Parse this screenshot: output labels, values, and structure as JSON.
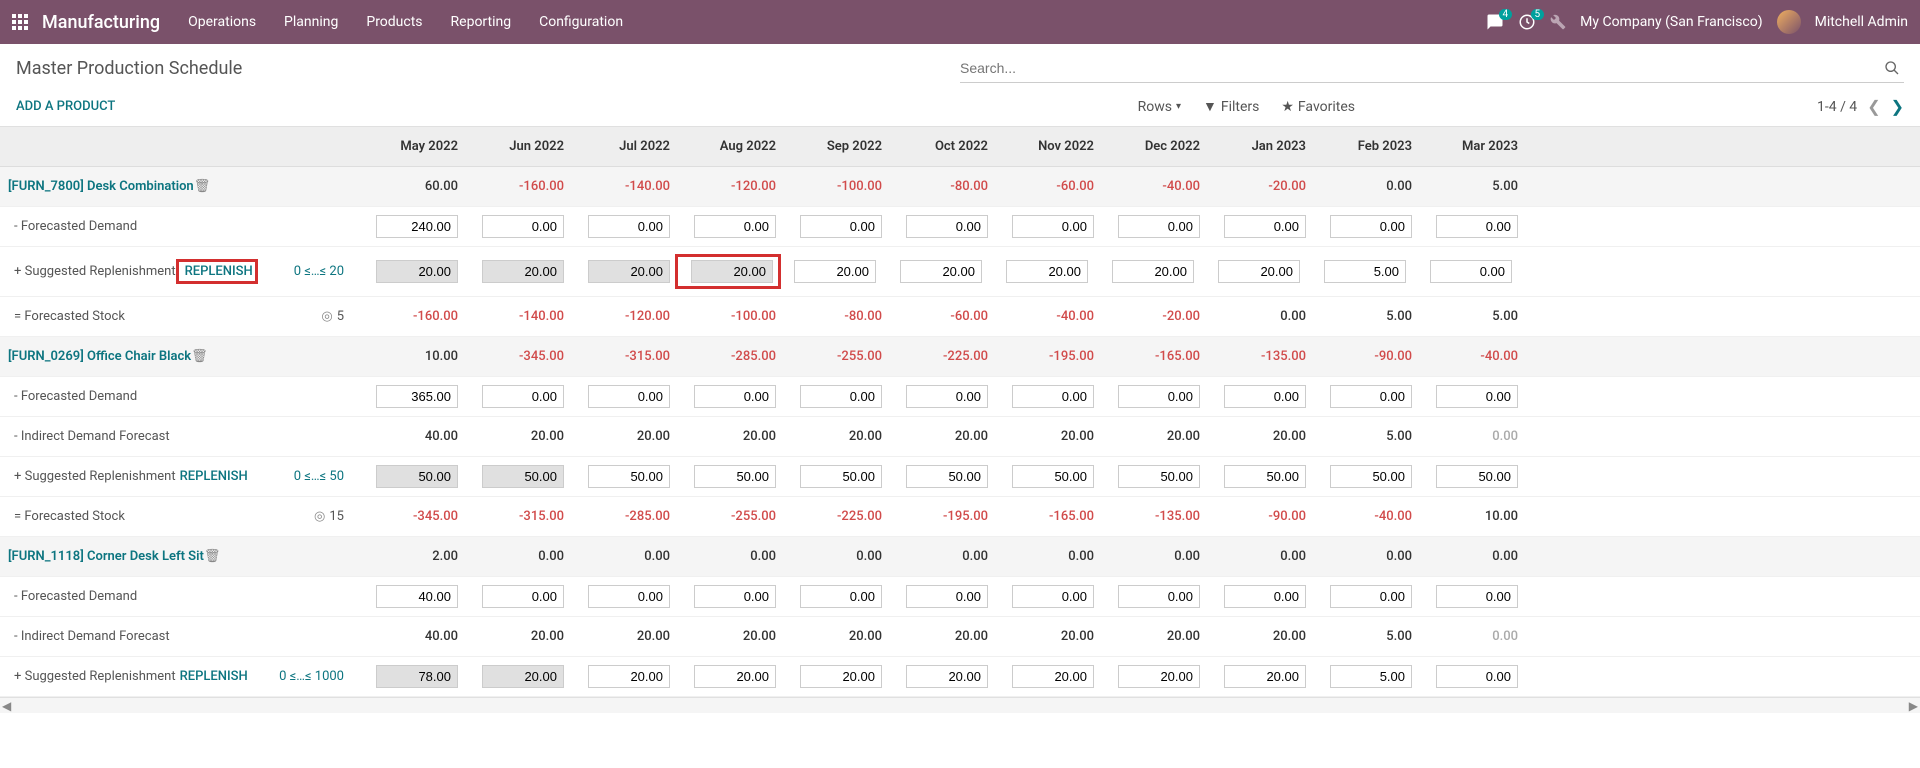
{
  "header": {
    "brand": "Manufacturing",
    "menu": [
      "Operations",
      "Planning",
      "Products",
      "Reporting",
      "Configuration"
    ],
    "chat_badge": "4",
    "activity_badge": "5",
    "company": "My Company (San Francisco)",
    "user": "Mitchell Admin"
  },
  "control": {
    "title": "Master Production Schedule",
    "search_placeholder": "Search...",
    "add_product": "ADD A PRODUCT",
    "rows_btn": "Rows",
    "filters_btn": "Filters",
    "favorites_btn": "Favorites",
    "pager": "1-4 / 4"
  },
  "columns": [
    "May 2022",
    "Jun 2022",
    "Jul 2022",
    "Aug 2022",
    "Sep 2022",
    "Oct 2022",
    "Nov 2022",
    "Dec 2022",
    "Jan 2023",
    "Feb 2023",
    "Mar 2023"
  ],
  "row_types": {
    "demand": "- Forecasted Demand",
    "indirect": "- Indirect Demand Forecast",
    "replenish": "+ Suggested Replenishment",
    "replenish_btn": "REPLENISH",
    "stock": "= Forecasted Stock"
  },
  "products": [
    {
      "name": "[FURN_7800] Desk Combination",
      "constraint": "0 ≤…≤ 20",
      "target": "5",
      "header_vals": [
        "60.00",
        "-160.00",
        "-140.00",
        "-120.00",
        "-100.00",
        "-80.00",
        "-60.00",
        "-40.00",
        "-20.00",
        "0.00",
        "5.00"
      ],
      "header_neg": [
        false,
        true,
        true,
        true,
        true,
        true,
        true,
        true,
        true,
        false,
        false
      ],
      "demand": [
        "240.00",
        "0.00",
        "0.00",
        "0.00",
        "0.00",
        "0.00",
        "0.00",
        "0.00",
        "0.00",
        "0.00",
        "0.00"
      ],
      "replenish": [
        "20.00",
        "20.00",
        "20.00",
        "20.00",
        "20.00",
        "20.00",
        "20.00",
        "20.00",
        "20.00",
        "5.00",
        "0.00"
      ],
      "replenish_gray": [
        true,
        true,
        true,
        true,
        false,
        false,
        false,
        false,
        false,
        false,
        false
      ],
      "stock": [
        "-160.00",
        "-140.00",
        "-120.00",
        "-100.00",
        "-80.00",
        "-60.00",
        "-40.00",
        "-20.00",
        "0.00",
        "5.00",
        "5.00"
      ],
      "stock_neg": [
        true,
        true,
        true,
        true,
        true,
        true,
        true,
        true,
        false,
        false,
        false
      ]
    },
    {
      "name": "[FURN_0269] Office Chair Black",
      "constraint": "0 ≤…≤ 50",
      "target": "15",
      "header_vals": [
        "10.00",
        "-345.00",
        "-315.00",
        "-285.00",
        "-255.00",
        "-225.00",
        "-195.00",
        "-165.00",
        "-135.00",
        "-90.00",
        "-40.00"
      ],
      "header_neg": [
        false,
        true,
        true,
        true,
        true,
        true,
        true,
        true,
        true,
        true,
        true
      ],
      "demand": [
        "365.00",
        "0.00",
        "0.00",
        "0.00",
        "0.00",
        "0.00",
        "0.00",
        "0.00",
        "0.00",
        "0.00",
        "0.00"
      ],
      "indirect": [
        "40.00",
        "20.00",
        "20.00",
        "20.00",
        "20.00",
        "20.00",
        "20.00",
        "20.00",
        "20.00",
        "5.00",
        "0.00"
      ],
      "indirect_muted": [
        false,
        false,
        false,
        false,
        false,
        false,
        false,
        false,
        false,
        false,
        true
      ],
      "replenish": [
        "50.00",
        "50.00",
        "50.00",
        "50.00",
        "50.00",
        "50.00",
        "50.00",
        "50.00",
        "50.00",
        "50.00",
        "50.00"
      ],
      "replenish_gray": [
        true,
        true,
        false,
        false,
        false,
        false,
        false,
        false,
        false,
        false,
        false
      ],
      "stock": [
        "-345.00",
        "-315.00",
        "-285.00",
        "-255.00",
        "-225.00",
        "-195.00",
        "-165.00",
        "-135.00",
        "-90.00",
        "-40.00",
        "10.00"
      ],
      "stock_neg": [
        true,
        true,
        true,
        true,
        true,
        true,
        true,
        true,
        true,
        true,
        false
      ]
    },
    {
      "name": "[FURN_1118] Corner Desk Left Sit",
      "constraint": "0 ≤…≤ 1000",
      "header_vals": [
        "2.00",
        "0.00",
        "0.00",
        "0.00",
        "0.00",
        "0.00",
        "0.00",
        "0.00",
        "0.00",
        "0.00",
        "0.00"
      ],
      "header_neg": [
        false,
        false,
        false,
        false,
        false,
        false,
        false,
        false,
        false,
        false,
        false
      ],
      "demand": [
        "40.00",
        "0.00",
        "0.00",
        "0.00",
        "0.00",
        "0.00",
        "0.00",
        "0.00",
        "0.00",
        "0.00",
        "0.00"
      ],
      "indirect": [
        "40.00",
        "20.00",
        "20.00",
        "20.00",
        "20.00",
        "20.00",
        "20.00",
        "20.00",
        "20.00",
        "5.00",
        "0.00"
      ],
      "indirect_muted": [
        false,
        false,
        false,
        false,
        false,
        false,
        false,
        false,
        false,
        false,
        true
      ],
      "replenish": [
        "78.00",
        "20.00",
        "20.00",
        "20.00",
        "20.00",
        "20.00",
        "20.00",
        "20.00",
        "20.00",
        "5.00",
        "0.00"
      ],
      "replenish_gray": [
        true,
        true,
        false,
        false,
        false,
        false,
        false,
        false,
        false,
        false,
        false
      ]
    }
  ]
}
